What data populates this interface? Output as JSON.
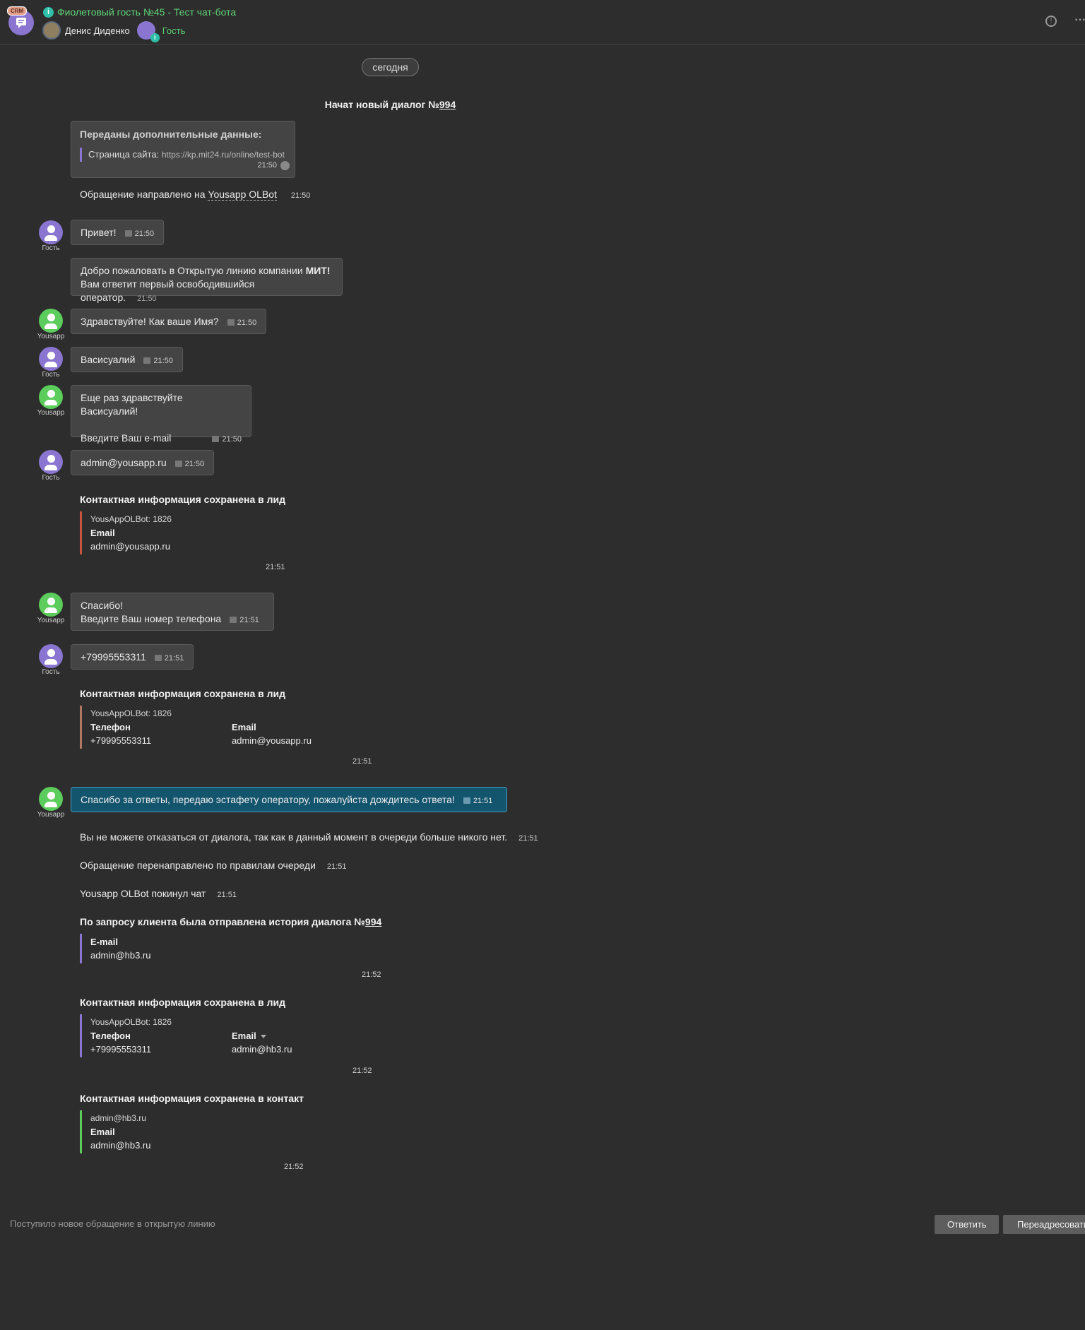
{
  "header": {
    "badge": "CRM",
    "title": "Фиолетовый гость №45 - Тест чат-бота",
    "operator_name": "Денис Диденко",
    "guest_label": "Гость"
  },
  "date_pill": "сегодня",
  "dialog_start": {
    "prefix": "Начат новый диалог №",
    "number": "994"
  },
  "extra_data": {
    "title": "Переданы дополнительные данные:",
    "label": "Страница сайта:",
    "url": "https://kp.mit24.ru/online/test-bot",
    "time": "21:50"
  },
  "routed": {
    "text": "Обращение направлено на",
    "target": "Yousapp OLBot",
    "time": "21:50"
  },
  "messages": {
    "m1": {
      "text": "Привет!",
      "time": "21:50",
      "author": "Гость"
    },
    "m2": {
      "line1_prefix": "Добро пожаловать в Открытую линию компании ",
      "line1_bold": "МИТ!",
      "line2": "Вам ответит первый освободившийся оператор.",
      "time": "21:50"
    },
    "m3": {
      "text": "Здравствуйте! Как ваше Имя?",
      "time": "21:50",
      "author": "Yousapp"
    },
    "m4": {
      "text": "Васисуалий",
      "time": "21:50",
      "author": "Гость"
    },
    "m5": {
      "line1": "Еще раз здравствуйте Васисуалий!",
      "line2": "Введите Ваш e-mail",
      "time": "21:50",
      "author": "Yousapp"
    },
    "m6": {
      "text": "admin@yousapp.ru",
      "time": "21:50",
      "author": "Гость"
    },
    "m7": {
      "line1": "Спасибо!",
      "line2": "Введите Ваш номер телефона",
      "time": "21:51",
      "author": "Yousapp"
    },
    "m8": {
      "text": "+79995553311",
      "time": "21:51",
      "author": "Гость"
    },
    "m9": {
      "text": "Спасибо за ответы, передаю эстафету оператору, пожалуйста дождитесь ответа!",
      "time": "21:51",
      "author": "Yousapp"
    }
  },
  "card1": {
    "title": "Контактная информация сохранена в лид",
    "sub": "YousAppOLBot: 1826",
    "label": "Email",
    "value": "admin@yousapp.ru",
    "time": "21:51"
  },
  "card2": {
    "title": "Контактная информация сохранена в лид",
    "sub": "YousAppOLBot: 1826",
    "label1": "Телефон",
    "value1": "+79995553311",
    "label2": "Email",
    "value2": "admin@yousapp.ru",
    "time": "21:51"
  },
  "sys": {
    "s1": {
      "text": "Вы не можете отказаться от диалога, так как в данный момент в очереди больше никого нет.",
      "time": "21:51"
    },
    "s2": {
      "text": "Обращение перенаправлено по правилам очереди",
      "time": "21:51"
    },
    "s3": {
      "text": "Yousapp OLBot покинул чат",
      "time": "21:51"
    }
  },
  "card3": {
    "title_prefix": "По запросу клиента была отправлена история диалога №",
    "number": "994",
    "label": "E-mail",
    "value": "admin@hb3.ru",
    "time": "21:52"
  },
  "card4": {
    "title": "Контактная информация сохранена в лид",
    "sub": "YousAppOLBot: 1826",
    "label1": "Телефон",
    "value1": "+79995553311",
    "label2": "Email",
    "value2": "admin@hb3.ru",
    "time": "21:52"
  },
  "card5": {
    "title": "Контактная информация сохранена в контакт",
    "sub": "admin@hb3.ru",
    "label": "Email",
    "value": "admin@hb3.ru",
    "time": "21:52"
  },
  "footer": {
    "notice": "Поступило новое обращение в открытую линию",
    "reply": "Ответить",
    "forward": "Переадресовать"
  },
  "colors": {
    "accent_green": "#5fd276",
    "guest_purple": "#8a76d0",
    "bot_green": "#5ccd5c",
    "highlight_blue": "#14556e"
  }
}
